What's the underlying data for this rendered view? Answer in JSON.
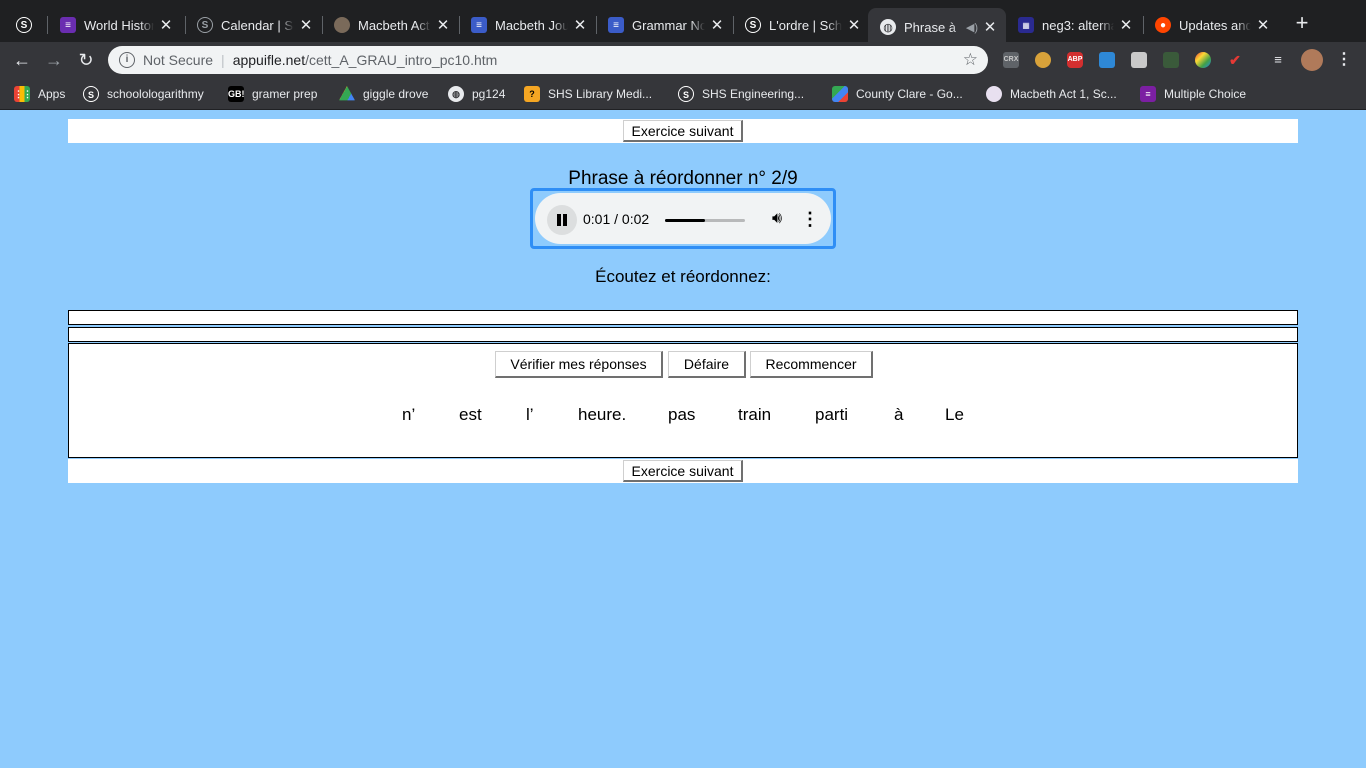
{
  "browser": {
    "tabs": [
      {
        "title": "",
        "icon": "schoology-icon",
        "color": "#ffffff"
      },
      {
        "title": "World Histor",
        "icon": "list-icon",
        "color": "#7b3fbf"
      },
      {
        "title": "Calendar | Sc",
        "icon": "schoology-icon",
        "color": "#ffffff"
      },
      {
        "title": "Macbeth Act",
        "icon": "slides-icon",
        "color": "#8b7b6a"
      },
      {
        "title": "Macbeth Jou",
        "icon": "docs-icon",
        "color": "#4a6ee0"
      },
      {
        "title": "Grammar No",
        "icon": "docs-icon",
        "color": "#4a6ee0"
      },
      {
        "title": "L'ordre | Sch",
        "icon": "schoology-icon",
        "color": "#ffffff"
      },
      {
        "title": "Phrase à",
        "icon": "globe-icon",
        "color": "#ffffff"
      },
      {
        "title": "neg3: alterna",
        "icon": "grid-icon",
        "color": "#3c3cc8"
      },
      {
        "title": "Updates and",
        "icon": "reddit-icon",
        "color": "#ff4500"
      }
    ],
    "new_tab": "+",
    "address": {
      "security": "Not Secure",
      "host": "appuifle.net",
      "path": "/cett_A_GRAU_intro_pc10.htm"
    },
    "extensions": [
      "CRX",
      "ABP"
    ],
    "bookmarks": [
      {
        "label": "Apps",
        "icon": "apps-grid-icon"
      },
      {
        "label": "schoolologarithmy",
        "icon": "schoology-icon"
      },
      {
        "label": "gramer prep",
        "icon": "gb-icon"
      },
      {
        "label": "giggle drove",
        "icon": "drive-icon"
      },
      {
        "label": "pg124",
        "icon": "globe-icon"
      },
      {
        "label": "SHS Library Medi...",
        "icon": "library-icon"
      },
      {
        "label": "SHS Engineering...",
        "icon": "schoology-icon"
      },
      {
        "label": "County Clare - Go...",
        "icon": "maps-icon"
      },
      {
        "label": "Macbeth Act 1, Sc...",
        "icon": "slides-icon"
      },
      {
        "label": "Multiple Choice",
        "icon": "forms-icon"
      }
    ]
  },
  "page": {
    "next_label": "Exercice suivant",
    "heading": "Phrase à réordonner n° 2/9",
    "audio": {
      "time": "0:01 / 0:02",
      "progress": 0.5
    },
    "instruction": "Écoutez et réordonnez:",
    "actions": {
      "check": "Vérifier mes réponses",
      "undo": "Défaire",
      "restart": "Recommencer"
    },
    "words": [
      "n’",
      "est",
      "l’",
      "heure.",
      "pas",
      "train",
      "parti",
      "à",
      "Le"
    ]
  }
}
